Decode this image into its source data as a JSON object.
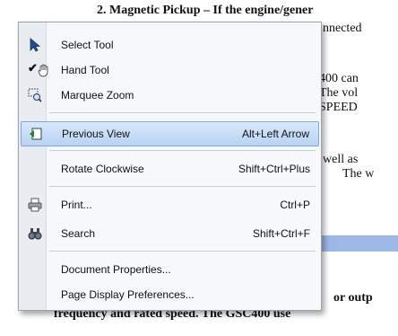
{
  "document": {
    "lines": [
      "2.  Magnetic Pickup – If the engine/gener",
      "nnected",
      "400 can",
      "The vol",
      "SPEED",
      "well as",
      "The w",
      "or outp",
      "frequency and rated speed.  The GSC400 use"
    ]
  },
  "menu": {
    "items": [
      {
        "label": "Select Tool",
        "shortcut": "",
        "icon": "arrow-cursor-icon",
        "checked": false
      },
      {
        "label": "Hand Tool",
        "shortcut": "",
        "icon": "hand-icon",
        "checked": true
      },
      {
        "label": "Marquee Zoom",
        "shortcut": "",
        "icon": "marquee-zoom-icon",
        "checked": false
      },
      {
        "label": "Previous View",
        "shortcut": "Alt+Left Arrow",
        "icon": "previous-view-icon",
        "checked": false
      },
      {
        "label": "Rotate Clockwise",
        "shortcut": "Shift+Ctrl+Plus",
        "icon": "",
        "checked": false
      },
      {
        "label": "Print...",
        "shortcut": "Ctrl+P",
        "icon": "printer-icon",
        "checked": false
      },
      {
        "label": "Search",
        "shortcut": "Shift+Ctrl+F",
        "icon": "search-binoculars-icon",
        "checked": false
      },
      {
        "label": "Document Properties...",
        "shortcut": "",
        "icon": "",
        "checked": false
      },
      {
        "label": "Page Display Preferences...",
        "shortcut": "",
        "icon": "",
        "checked": false
      }
    ],
    "check_mark": "✔",
    "highlight_color": "#b9d3f3"
  }
}
